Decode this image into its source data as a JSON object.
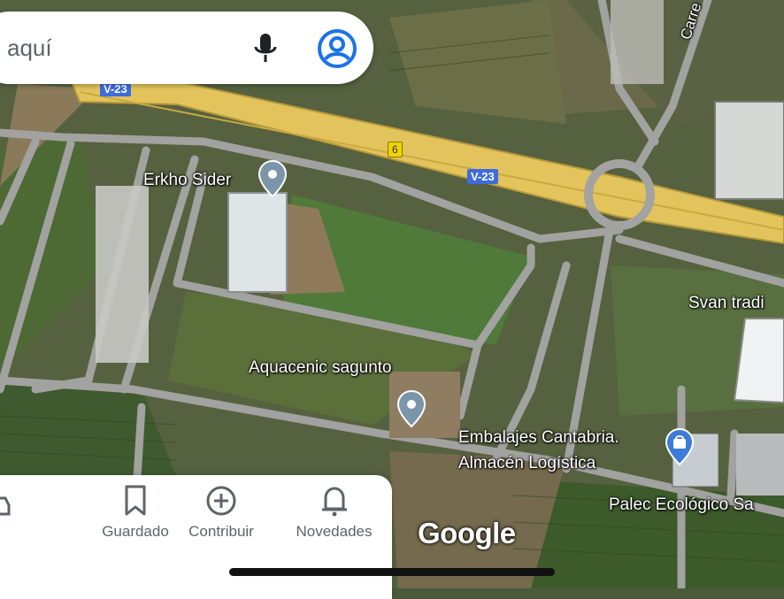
{
  "search": {
    "placeholder": "aquí"
  },
  "map": {
    "place_labels": [
      {
        "text": "Erkho Sider"
      },
      {
        "text": "Aquacenic sagunto"
      },
      {
        "text": "Embalajes Cantabria."
      },
      {
        "text": "Almacén Logística"
      },
      {
        "text": "Svan tradi"
      },
      {
        "text": "Palec Ecológico Sa"
      }
    ],
    "road_labels": {
      "v23_top": "V-23",
      "v23_mid": "V-23",
      "exit": "6",
      "carrer": "Carre"
    },
    "attribution": "Google"
  },
  "bottom_nav": {
    "items": [
      {
        "label": "Guardado",
        "icon": "bookmark-icon"
      },
      {
        "label": "Contribuir",
        "icon": "add-circle-icon"
      },
      {
        "label": "Novedades",
        "icon": "bell-icon"
      }
    ]
  },
  "colors": {
    "highway": "#e8c85a",
    "road": "#9a9a98",
    "accent": "#1a73e8",
    "pin": "#7a96a8",
    "shop_pin": "#3d7bd9"
  }
}
